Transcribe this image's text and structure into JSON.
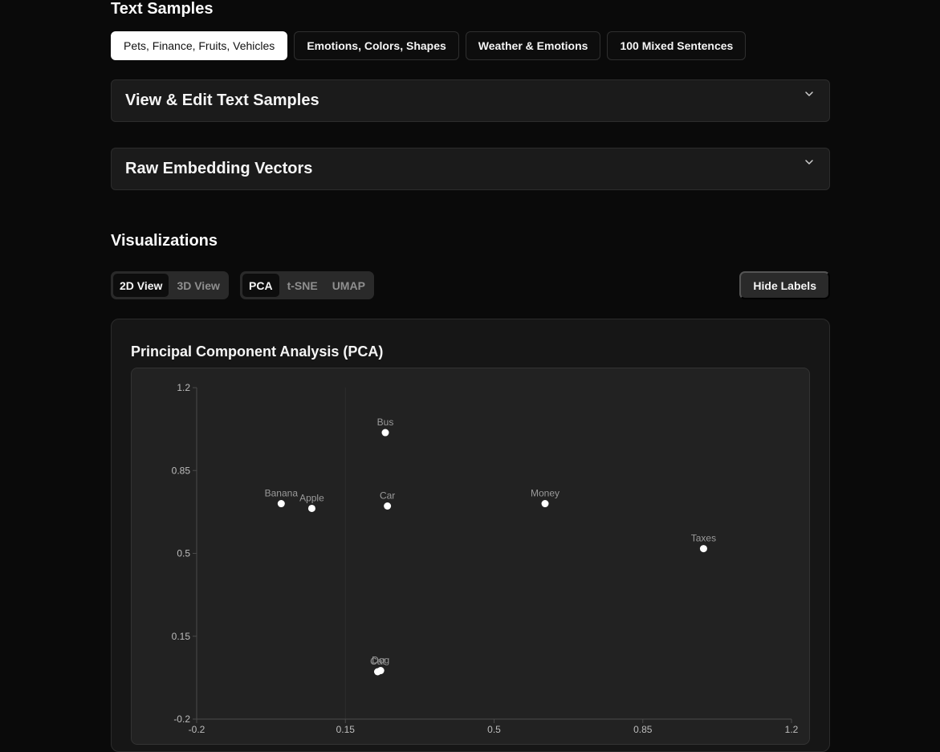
{
  "samples": {
    "title": "Text Samples",
    "presets": [
      {
        "label": "Pets, Finance, Fruits, Vehicles",
        "active": true
      },
      {
        "label": "Emotions, Colors, Shapes",
        "active": false
      },
      {
        "label": "Weather & Emotions",
        "active": false
      },
      {
        "label": "100 Mixed Sentences",
        "active": false
      }
    ],
    "view_edit_title": "View & Edit Text Samples",
    "raw_title": "Raw Embedding Vectors"
  },
  "visualizations": {
    "title": "Visualizations",
    "view_options": [
      "2D View",
      "3D View"
    ],
    "view_selected": "2D View",
    "algo_options": [
      "PCA",
      "t-SNE",
      "UMAP"
    ],
    "algo_selected": "PCA",
    "hide_labels": "Hide Labels",
    "card_title": "Principal Component Analysis (PCA)"
  },
  "chart_data": {
    "type": "scatter",
    "title": "Principal Component Analysis (PCA)",
    "xlim": [
      -0.2,
      1.2
    ],
    "ylim": [
      -0.2,
      1.2
    ],
    "xticks": [
      "-0.2",
      "0.15",
      "0.5",
      "0.85",
      "1.2"
    ],
    "yticks": [
      "-0.2",
      "0.15",
      "0.5",
      "0.85",
      "1.2"
    ],
    "grid": false,
    "points": [
      {
        "label": "Bus",
        "x": 0.244,
        "y": 1.01
      },
      {
        "label": "Banana",
        "x": -0.001,
        "y": 0.71
      },
      {
        "label": "Apple",
        "x": 0.071,
        "y": 0.69
      },
      {
        "label": "Car",
        "x": 0.249,
        "y": 0.7
      },
      {
        "label": "Money",
        "x": 0.62,
        "y": 0.71
      },
      {
        "label": "Taxes",
        "x": 0.993,
        "y": 0.52
      },
      {
        "label": "Dog",
        "x": 0.233,
        "y": 0.005
      },
      {
        "label": "Cat",
        "x": 0.226,
        "y": 0.0
      }
    ],
    "colors": {
      "point": "#ffffff",
      "label": "#9a9a9a",
      "axis": "#4a4a4a",
      "tick": "#bdbdbd"
    }
  }
}
